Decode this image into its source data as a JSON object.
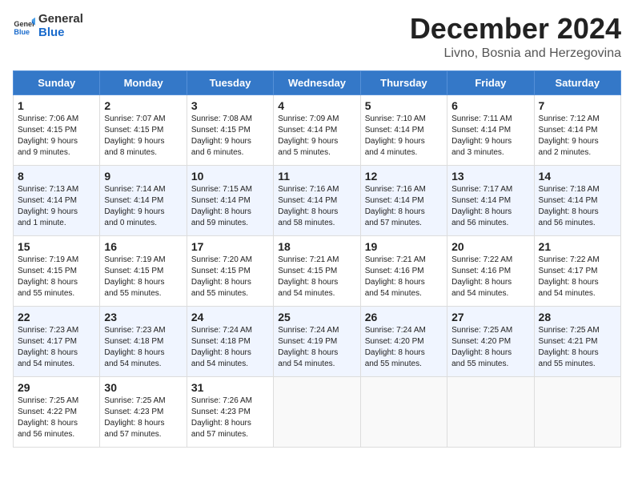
{
  "header": {
    "logo_general": "General",
    "logo_blue": "Blue",
    "month_title": "December 2024",
    "location": "Livno, Bosnia and Herzegovina"
  },
  "columns": [
    "Sunday",
    "Monday",
    "Tuesday",
    "Wednesday",
    "Thursday",
    "Friday",
    "Saturday"
  ],
  "weeks": [
    [
      {
        "day": "1",
        "lines": [
          "Sunrise: 7:06 AM",
          "Sunset: 4:15 PM",
          "Daylight: 9 hours",
          "and 9 minutes."
        ]
      },
      {
        "day": "2",
        "lines": [
          "Sunrise: 7:07 AM",
          "Sunset: 4:15 PM",
          "Daylight: 9 hours",
          "and 8 minutes."
        ]
      },
      {
        "day": "3",
        "lines": [
          "Sunrise: 7:08 AM",
          "Sunset: 4:15 PM",
          "Daylight: 9 hours",
          "and 6 minutes."
        ]
      },
      {
        "day": "4",
        "lines": [
          "Sunrise: 7:09 AM",
          "Sunset: 4:14 PM",
          "Daylight: 9 hours",
          "and 5 minutes."
        ]
      },
      {
        "day": "5",
        "lines": [
          "Sunrise: 7:10 AM",
          "Sunset: 4:14 PM",
          "Daylight: 9 hours",
          "and 4 minutes."
        ]
      },
      {
        "day": "6",
        "lines": [
          "Sunrise: 7:11 AM",
          "Sunset: 4:14 PM",
          "Daylight: 9 hours",
          "and 3 minutes."
        ]
      },
      {
        "day": "7",
        "lines": [
          "Sunrise: 7:12 AM",
          "Sunset: 4:14 PM",
          "Daylight: 9 hours",
          "and 2 minutes."
        ]
      }
    ],
    [
      {
        "day": "8",
        "lines": [
          "Sunrise: 7:13 AM",
          "Sunset: 4:14 PM",
          "Daylight: 9 hours",
          "and 1 minute."
        ]
      },
      {
        "day": "9",
        "lines": [
          "Sunrise: 7:14 AM",
          "Sunset: 4:14 PM",
          "Daylight: 9 hours",
          "and 0 minutes."
        ]
      },
      {
        "day": "10",
        "lines": [
          "Sunrise: 7:15 AM",
          "Sunset: 4:14 PM",
          "Daylight: 8 hours",
          "and 59 minutes."
        ]
      },
      {
        "day": "11",
        "lines": [
          "Sunrise: 7:16 AM",
          "Sunset: 4:14 PM",
          "Daylight: 8 hours",
          "and 58 minutes."
        ]
      },
      {
        "day": "12",
        "lines": [
          "Sunrise: 7:16 AM",
          "Sunset: 4:14 PM",
          "Daylight: 8 hours",
          "and 57 minutes."
        ]
      },
      {
        "day": "13",
        "lines": [
          "Sunrise: 7:17 AM",
          "Sunset: 4:14 PM",
          "Daylight: 8 hours",
          "and 56 minutes."
        ]
      },
      {
        "day": "14",
        "lines": [
          "Sunrise: 7:18 AM",
          "Sunset: 4:14 PM",
          "Daylight: 8 hours",
          "and 56 minutes."
        ]
      }
    ],
    [
      {
        "day": "15",
        "lines": [
          "Sunrise: 7:19 AM",
          "Sunset: 4:15 PM",
          "Daylight: 8 hours",
          "and 55 minutes."
        ]
      },
      {
        "day": "16",
        "lines": [
          "Sunrise: 7:19 AM",
          "Sunset: 4:15 PM",
          "Daylight: 8 hours",
          "and 55 minutes."
        ]
      },
      {
        "day": "17",
        "lines": [
          "Sunrise: 7:20 AM",
          "Sunset: 4:15 PM",
          "Daylight: 8 hours",
          "and 55 minutes."
        ]
      },
      {
        "day": "18",
        "lines": [
          "Sunrise: 7:21 AM",
          "Sunset: 4:15 PM",
          "Daylight: 8 hours",
          "and 54 minutes."
        ]
      },
      {
        "day": "19",
        "lines": [
          "Sunrise: 7:21 AM",
          "Sunset: 4:16 PM",
          "Daylight: 8 hours",
          "and 54 minutes."
        ]
      },
      {
        "day": "20",
        "lines": [
          "Sunrise: 7:22 AM",
          "Sunset: 4:16 PM",
          "Daylight: 8 hours",
          "and 54 minutes."
        ]
      },
      {
        "day": "21",
        "lines": [
          "Sunrise: 7:22 AM",
          "Sunset: 4:17 PM",
          "Daylight: 8 hours",
          "and 54 minutes."
        ]
      }
    ],
    [
      {
        "day": "22",
        "lines": [
          "Sunrise: 7:23 AM",
          "Sunset: 4:17 PM",
          "Daylight: 8 hours",
          "and 54 minutes."
        ]
      },
      {
        "day": "23",
        "lines": [
          "Sunrise: 7:23 AM",
          "Sunset: 4:18 PM",
          "Daylight: 8 hours",
          "and 54 minutes."
        ]
      },
      {
        "day": "24",
        "lines": [
          "Sunrise: 7:24 AM",
          "Sunset: 4:18 PM",
          "Daylight: 8 hours",
          "and 54 minutes."
        ]
      },
      {
        "day": "25",
        "lines": [
          "Sunrise: 7:24 AM",
          "Sunset: 4:19 PM",
          "Daylight: 8 hours",
          "and 54 minutes."
        ]
      },
      {
        "day": "26",
        "lines": [
          "Sunrise: 7:24 AM",
          "Sunset: 4:20 PM",
          "Daylight: 8 hours",
          "and 55 minutes."
        ]
      },
      {
        "day": "27",
        "lines": [
          "Sunrise: 7:25 AM",
          "Sunset: 4:20 PM",
          "Daylight: 8 hours",
          "and 55 minutes."
        ]
      },
      {
        "day": "28",
        "lines": [
          "Sunrise: 7:25 AM",
          "Sunset: 4:21 PM",
          "Daylight: 8 hours",
          "and 55 minutes."
        ]
      }
    ],
    [
      {
        "day": "29",
        "lines": [
          "Sunrise: 7:25 AM",
          "Sunset: 4:22 PM",
          "Daylight: 8 hours",
          "and 56 minutes."
        ]
      },
      {
        "day": "30",
        "lines": [
          "Sunrise: 7:25 AM",
          "Sunset: 4:23 PM",
          "Daylight: 8 hours",
          "and 57 minutes."
        ]
      },
      {
        "day": "31",
        "lines": [
          "Sunrise: 7:26 AM",
          "Sunset: 4:23 PM",
          "Daylight: 8 hours",
          "and 57 minutes."
        ]
      },
      null,
      null,
      null,
      null
    ]
  ]
}
